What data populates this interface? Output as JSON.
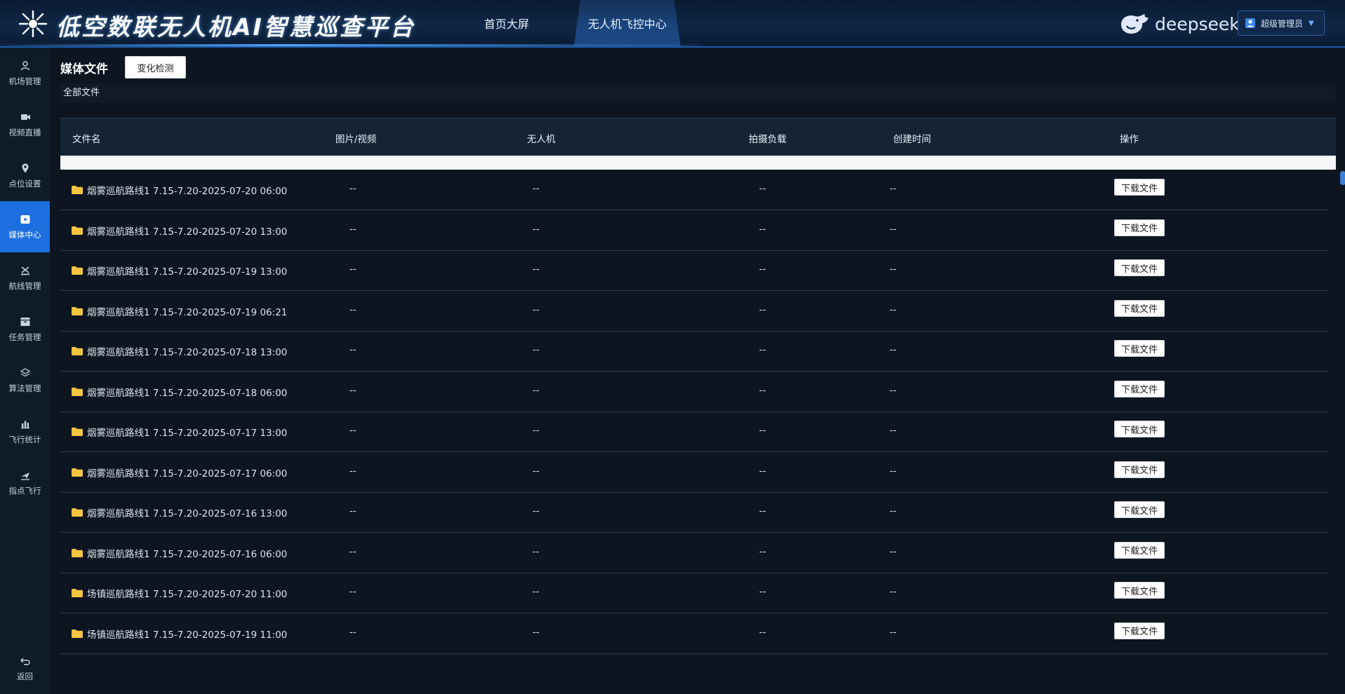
{
  "header": {
    "title": "低空数联无人机AI智慧巡查平台",
    "nav": [
      {
        "label": "首页大屏"
      },
      {
        "label": "无人机飞控中心"
      }
    ],
    "brand": "deepseek",
    "user": "超级管理员"
  },
  "sidebar": {
    "items": [
      {
        "label": "机场管理",
        "icon": "airport-user-icon"
      },
      {
        "label": "视频直播",
        "icon": "video-icon"
      },
      {
        "label": "点位设置",
        "icon": "location-pin-icon"
      },
      {
        "label": "媒体中心",
        "icon": "media-play-icon",
        "active": true
      },
      {
        "label": "航线管理",
        "icon": "route-icon"
      },
      {
        "label": "任务管理",
        "icon": "task-box-icon"
      },
      {
        "label": "算法管理",
        "icon": "layers-icon"
      },
      {
        "label": "飞行统计",
        "icon": "bar-chart-icon"
      },
      {
        "label": "指点飞行",
        "icon": "point-flight-icon"
      }
    ],
    "back": "返回"
  },
  "page": {
    "title": "媒体文件",
    "change_button": "变化检测",
    "breadcrumb": "全部文件"
  },
  "table": {
    "columns": [
      "文件名",
      "图片/视频",
      "无人机",
      "拍摄负载",
      "创建时间",
      "操作"
    ],
    "download_label": "下载文件",
    "rows": [
      {
        "name": "烟雾巡航路线1 7.15-7.20-2025-07-20 06:00",
        "type": "--",
        "drone": "--",
        "payload": "--",
        "created": "--"
      },
      {
        "name": "烟雾巡航路线1 7.15-7.20-2025-07-20 13:00",
        "type": "--",
        "drone": "--",
        "payload": "--",
        "created": "--"
      },
      {
        "name": "烟雾巡航路线1 7.15-7.20-2025-07-19 13:00",
        "type": "--",
        "drone": "--",
        "payload": "--",
        "created": "--"
      },
      {
        "name": "烟雾巡航路线1 7.15-7.20-2025-07-19 06:21",
        "type": "--",
        "drone": "--",
        "payload": "--",
        "created": "--"
      },
      {
        "name": "烟雾巡航路线1 7.15-7.20-2025-07-18 13:00",
        "type": "--",
        "drone": "--",
        "payload": "--",
        "created": "--"
      },
      {
        "name": "烟雾巡航路线1 7.15-7.20-2025-07-18 06:00",
        "type": "--",
        "drone": "--",
        "payload": "--",
        "created": "--"
      },
      {
        "name": "烟雾巡航路线1 7.15-7.20-2025-07-17 13:00",
        "type": "--",
        "drone": "--",
        "payload": "--",
        "created": "--"
      },
      {
        "name": "烟雾巡航路线1 7.15-7.20-2025-07-17 06:00",
        "type": "--",
        "drone": "--",
        "payload": "--",
        "created": "--"
      },
      {
        "name": "烟雾巡航路线1 7.15-7.20-2025-07-16 13:00",
        "type": "--",
        "drone": "--",
        "payload": "--",
        "created": "--"
      },
      {
        "name": "烟雾巡航路线1 7.15-7.20-2025-07-16 06:00",
        "type": "--",
        "drone": "--",
        "payload": "--",
        "created": "--"
      },
      {
        "name": "场镇巡航路线1 7.15-7.20-2025-07-20 11:00",
        "type": "--",
        "drone": "--",
        "payload": "--",
        "created": "--"
      },
      {
        "name": "场镇巡航路线1 7.15-7.20-2025-07-19 11:00",
        "type": "--",
        "drone": "--",
        "payload": "--",
        "created": "--"
      }
    ]
  },
  "colors": {
    "accent": "#1d6fe0",
    "folder": "#f5c441",
    "header_bg": "#0f2746",
    "page_bg": "#0d1520"
  }
}
